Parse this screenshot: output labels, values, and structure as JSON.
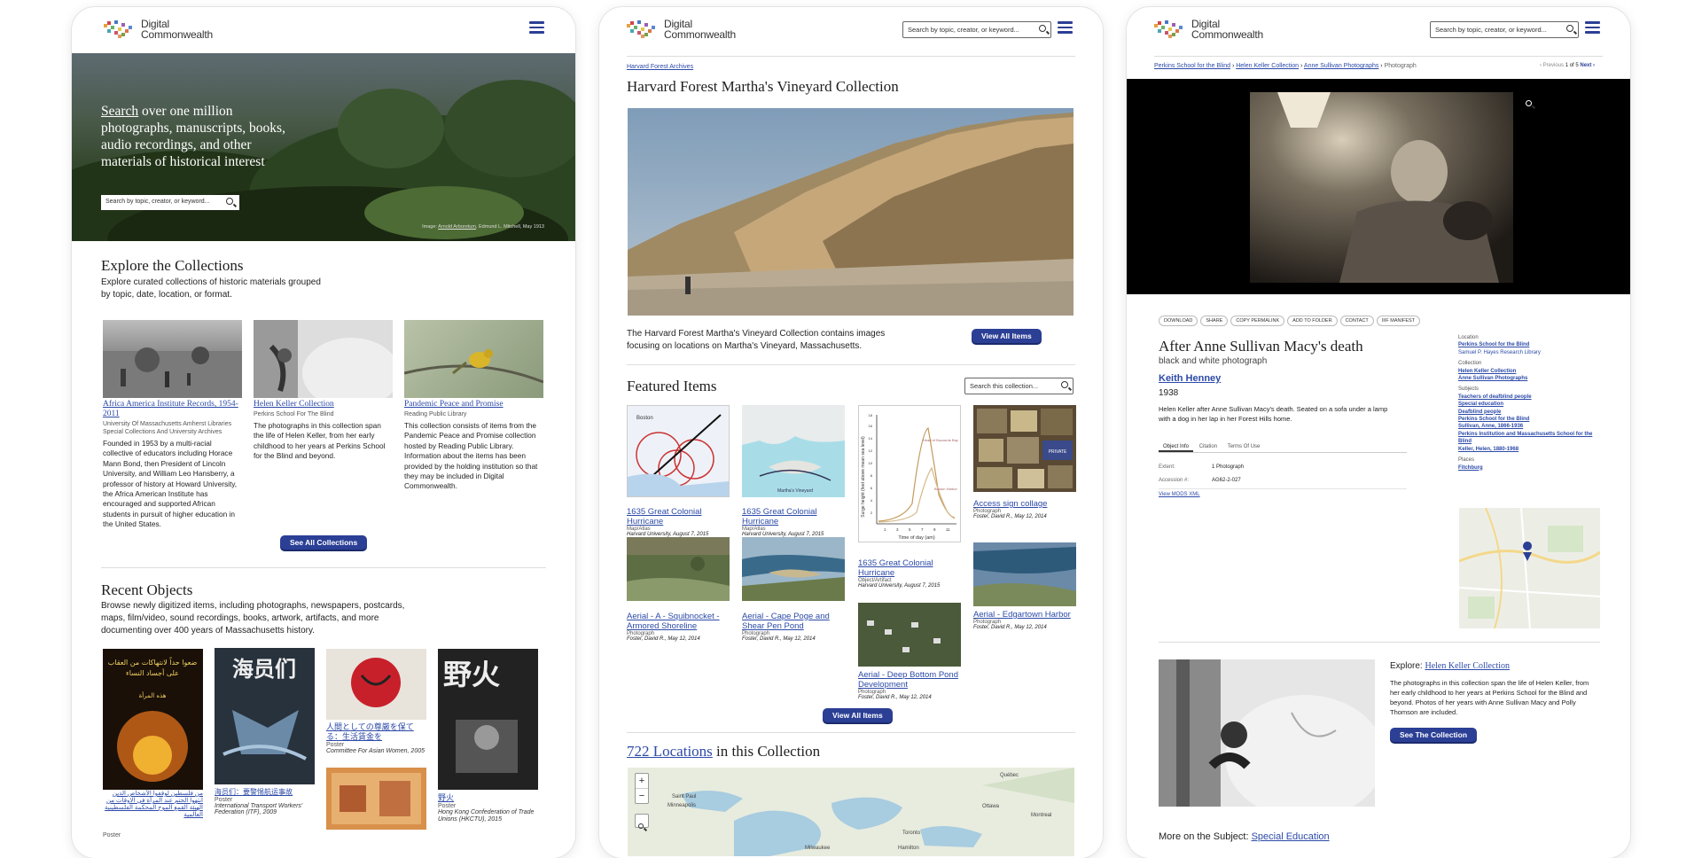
{
  "brand": {
    "line1": "Digital",
    "line2": "Commonwealth"
  },
  "colors": {
    "primary": "#2b3f95",
    "link": "#2c4aa8"
  },
  "screen1": {
    "hero": {
      "search_word": "Search",
      "heading_rest": " over one million photographs, manuscripts, books, audio recordings, and other materials of historical interest",
      "search_placeholder": "Search by topic, creator, or keyword...",
      "credit_prefix": "Image: ",
      "credit_link": "Arnold Arboretum",
      "credit_rest": ", Edmund L. Mitchell, May 1913"
    },
    "explore": {
      "title": "Explore the Collections",
      "desc": "Explore curated collections of historic materials grouped by topic, date, location, or format.",
      "items": [
        {
          "title": "Africa America Institute Records, 1954-2011",
          "inst": "University Of Massachusetts Amherst Libraries Special Collections And University Archives",
          "desc": "Founded in 1953 by a multi-racial collective of educators including Horace Mann Bond, then President of Lincoln University, and William Leo Hansberry, a professor of history at Howard University, the Africa American Institute has encouraged and supported African students in pursuit of higher education in the United States."
        },
        {
          "title": "Helen Keller Collection",
          "inst": "Perkins School For The Blind",
          "desc": "The photographs in this collection span the life of Helen Keller, from her early childhood to her years at Perkins School for the Blind and beyond."
        },
        {
          "title": "Pandemic Peace and Promise",
          "inst": "Reading Public Library",
          "desc": "This collection consists of items from the Pandemic Peace and Promise collection hosted by Reading Public Library. Information about the items has been provided by the holding institution so that they may be included in Digital Commonwealth."
        }
      ],
      "button": "See All Collections"
    },
    "recent": {
      "title": "Recent Objects",
      "desc": "Browse newly digitized items, including photographs, newspapers, postcards, maps, film/video, sound recordings, books, artwork, artifacts, and more documenting over 400 years of Massachusetts history.",
      "items": [
        {
          "title": "من فلسطين لوقفوا الأشخاص الذين انتهوا الحتم عند المرأة في الاوقات من الهيئة القمع الموح المحكمة الفلسطينية العالمية",
          "type": "Poster"
        },
        {
          "title": "海员们：要警惕航运事故",
          "type": "Poster",
          "inst": "International Transport Workers' Federation (ITF), 2009"
        },
        {
          "title": "人間としての尊厳を保てる：生活賃金を",
          "type": "Poster",
          "inst": "Committee For Asian Women, 2005"
        },
        {
          "title": "野火",
          "type": "Poster",
          "inst": "Hong Kong Confederation of Trade Unions (HKCTU), 2015"
        }
      ],
      "poster_text": {
        "arabic1": "ضعوا حداً لانتهاكات من العقاب",
        "arabic2": "على أجساد النساء",
        "arabic3": "هذه المرأة",
        "chinese": "海员们",
        "japanese": "野火"
      }
    }
  },
  "screen2": {
    "search_placeholder": "Search by topic, creator, or keyword...",
    "breadcrumb": "Harvard Forest Archives",
    "title": "Harvard Forest Martha's Vineyard Collection",
    "desc": "The Harvard Forest Martha's Vineyard Collection contains images focusing on locations on Martha's Vineyard, Massachusetts.",
    "view_all": "View All Items",
    "featured_title": "Featured Items",
    "collection_search": "Search this collection...",
    "items": [
      {
        "title": "1635 Great Colonial Hurricane",
        "type": "Map/Atlas",
        "inst": "Harvard University, August 7, 2015"
      },
      {
        "title": "1635 Great Colonial Hurricane",
        "type": "Map/Atlas",
        "inst": "Harvard University, August 7, 2015"
      },
      {
        "title": "1635 Great Colonial Hurricane",
        "type": "Object/Artifact",
        "inst": "Harvard University, August 7, 2015"
      },
      {
        "title": "Access sign collage",
        "type": "Photograph",
        "inst": "Foster, David R., May 12, 2014"
      },
      {
        "title": "Aerial - A - Squibnocket - Armored Shoreline",
        "type": "Photograph",
        "inst": "Foster, David R., May 12, 2014"
      },
      {
        "title": "Aerial - Cape Poge and Shear Pen Pond",
        "type": "Photograph",
        "inst": "Foster, David R., May 12, 2014"
      },
      {
        "title": "Aerial - Deep Bottom Pond Development",
        "type": "Photograph",
        "inst": "Foster, David R., May 12, 2014"
      },
      {
        "title": "Aerial - Edgartown Harbor",
        "type": "Photograph",
        "inst": "Foster, David R., May 12, 2014"
      }
    ],
    "view_all_bottom": "View All Items",
    "locations_link": "722 Locations",
    "locations_rest": " in this Collection",
    "map": {
      "zoom_in": "+",
      "zoom_out": "−",
      "labels": [
        "Québec",
        "Ottawa",
        "Montreal",
        "Toronto",
        "Hamilton",
        "Milwaukee",
        "Saint Paul",
        "Minneapolis"
      ]
    },
    "chart_text": {
      "ylabel": "Surge height (feet above mean sea level)",
      "xlabel": "Time of day (am)",
      "xticks": [
        "1",
        "3",
        "5",
        "7",
        "9",
        "11"
      ],
      "yticks": [
        "2",
        "4",
        "6",
        "8",
        "10",
        "12",
        "14",
        "16",
        "18"
      ],
      "note": "Boston Harbor",
      "legend1": "Head of Buzzards Bay"
    },
    "map1_text": {
      "city": "Boston",
      "place": "Martha's Vineyard"
    },
    "sign_text": {
      "sign": "PRIVATE"
    }
  },
  "screen3": {
    "search_placeholder": "Search by topic, creator, or keyword...",
    "breadcrumbs": [
      "Perkins School for the Blind",
      "Helen Keller Collection",
      "Anne Sullivan Photographs"
    ],
    "breadcrumb_current": "Photograph",
    "pager": {
      "prev": "‹ Previous",
      "count": "1 of 5",
      "next": "Next ›"
    },
    "tools": [
      "DOWNLOAD",
      "SHARE",
      "COPY PERMALINK",
      "ADD TO FOLDER",
      "CONTACT",
      "IIIF MANIFEST"
    ],
    "title": "After Anne Sullivan Macy's death",
    "subtitle": "black and white photograph",
    "creator": "Keith Henney",
    "year": "1938",
    "description": "Helen Keller after Anne Sullivan Macy's death. Seated on a sofa under a lamp with a dog in her lap in her Forest Hills home.",
    "tabs": [
      "Object Info",
      "Citation",
      "Terms Of Use"
    ],
    "fields": [
      {
        "label": "Extent:",
        "value": "1 Photograph"
      },
      {
        "label": "Accession #:",
        "value": "AG62-2-027"
      }
    ],
    "mods": "View MODS XML",
    "side": {
      "location_label": "Location",
      "location": [
        "Perkins School for the Blind",
        "Samuel P. Hayes Research Library"
      ],
      "collection_label": "Collection",
      "collection": [
        "Helen Keller Collection",
        "Anne Sullivan Photographs"
      ],
      "subjects_label": "Subjects",
      "subjects": [
        "Teachers of deafblind people",
        "Special education",
        "Deafblind people",
        "Perkins School for the Blind",
        "Sullivan, Anne, 1866-1936",
        "Perkins Institution and Massachusetts School for the Blind",
        "Keller, Helen, 1880-1968"
      ],
      "places_label": "Places",
      "places": [
        "Fitchburg"
      ]
    },
    "explore_prefix": "Explore: ",
    "explore_link": "Helen Keller Collection",
    "explore_desc": "The photographs in this collection span the life of Helen Keller, from her early childhood to her years at Perkins School for the Blind and beyond. Photos of her years with Anne Sullivan Macy and Polly Thomson are included.",
    "explore_button": "See The Collection",
    "more_prefix": "More on the Subject: ",
    "more_link": "Special Education"
  }
}
